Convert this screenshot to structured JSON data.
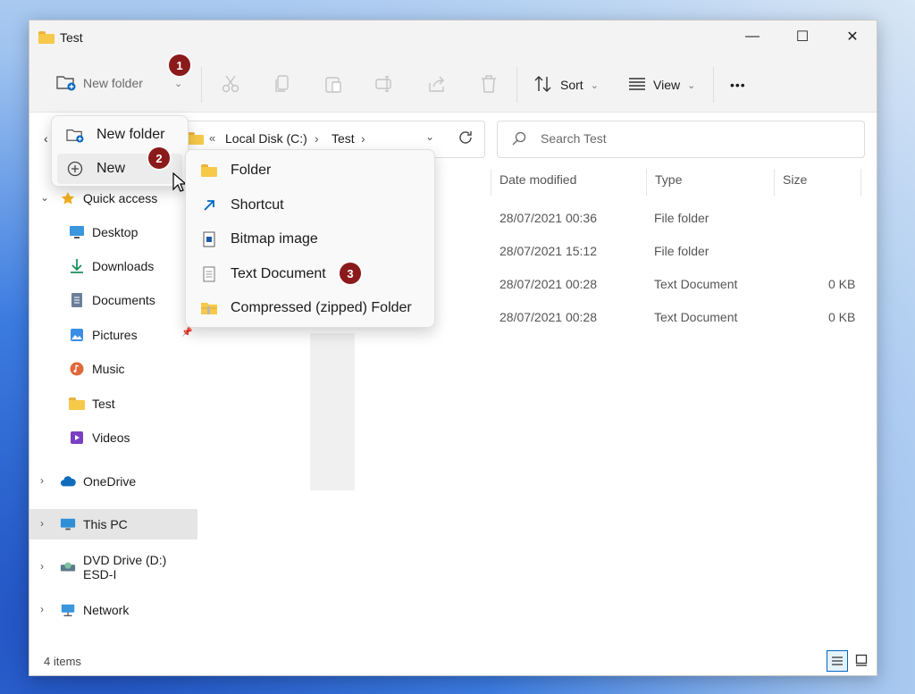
{
  "window": {
    "title": "Test",
    "minimize": "—",
    "maximize": "☐",
    "close": "✕"
  },
  "toolbar": {
    "new_folder_label": "New folder",
    "sort_label": "Sort",
    "view_label": "View",
    "more_label": "•••"
  },
  "badges": {
    "one": "1",
    "two": "2",
    "three": "3"
  },
  "address": {
    "overflow": "«",
    "crumbs": [
      "Local Disk (C:)",
      "Test"
    ],
    "separator": "›"
  },
  "search": {
    "placeholder": "Search Test"
  },
  "columns": {
    "date": "Date modified",
    "type": "Type",
    "size": "Size"
  },
  "files": [
    {
      "date": "28/07/2021 00:36",
      "type": "File folder",
      "size": ""
    },
    {
      "date": "28/07/2021 15:12",
      "type": "File folder",
      "size": ""
    },
    {
      "date": "28/07/2021 00:28",
      "type": "Text Document",
      "size": "0 KB"
    },
    {
      "date": "28/07/2021 00:28",
      "type": "Text Document",
      "size": "0 KB"
    }
  ],
  "nav": {
    "quick_access": "Quick access",
    "desktop": "Desktop",
    "downloads": "Downloads",
    "documents": "Documents",
    "pictures": "Pictures",
    "music": "Music",
    "test": "Test",
    "videos": "Videos",
    "onedrive": "OneDrive",
    "this_pc": "This PC",
    "dvd": "DVD Drive (D:) ESD-I",
    "network": "Network"
  },
  "menu1": {
    "new_folder": "New folder",
    "new": "New"
  },
  "menu2": {
    "folder": "Folder",
    "shortcut": "Shortcut",
    "bitmap": "Bitmap image",
    "text_document": "Text Document",
    "compressed": "Compressed (zipped) Folder"
  },
  "status": {
    "items": "4 items"
  },
  "colors": {
    "badge": "#8b1a1a",
    "folder": "#f7c948",
    "accent": "#0067c0"
  }
}
